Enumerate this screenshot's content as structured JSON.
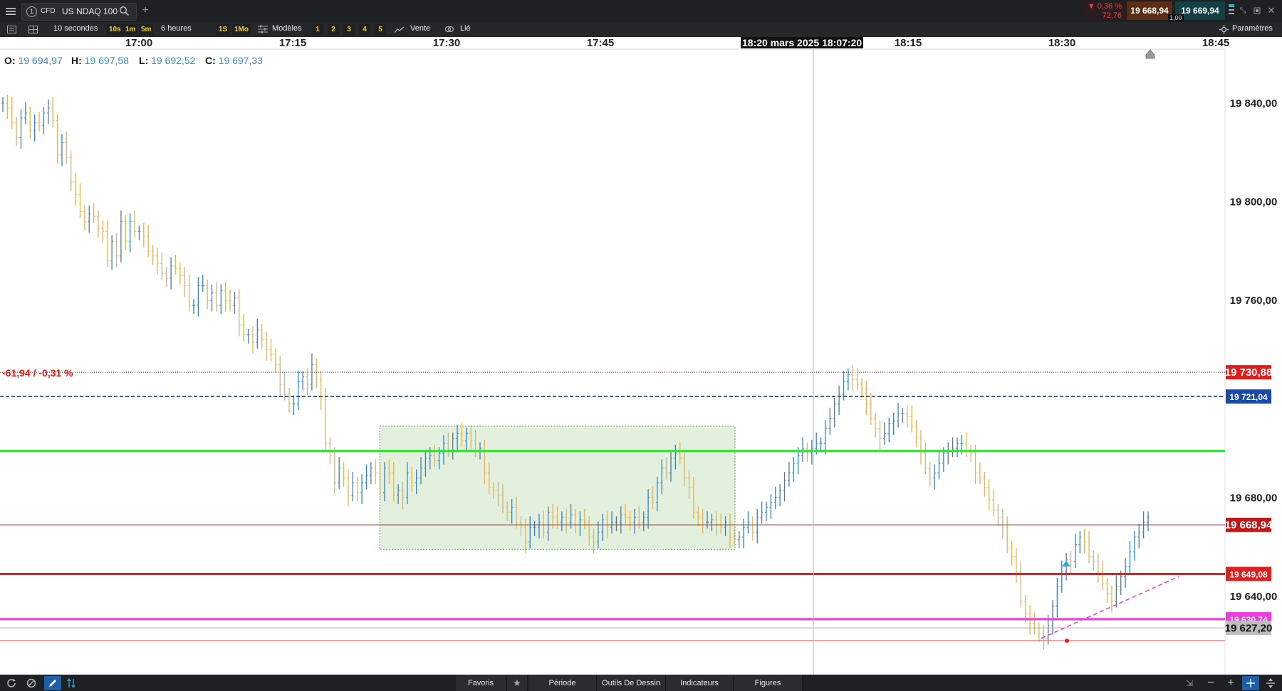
{
  "header": {
    "menu_icon": "hamburger-icon",
    "tab_number": "1",
    "instrument_type": "CFD",
    "instrument_name": "US NDAQ 100",
    "change_pct": "▼ 0,36 %",
    "change_abs": "72,76",
    "bid": "19 668,94",
    "ask": "19 669,94",
    "spread": "1,00"
  },
  "toolbar": {
    "interval": "10 secondes",
    "quick_intervals": [
      "10s",
      "1m",
      "5m"
    ],
    "range": "6 heures",
    "quick_ranges": [
      "1S",
      "1Mo"
    ],
    "templates_label": "Modèles",
    "template_slots": [
      "1",
      "2",
      "3",
      "4",
      "5"
    ],
    "sell_label": "Vente",
    "link_label": "Lié",
    "settings_label": "Paramètres"
  },
  "ohlc": {
    "o_label": "O:",
    "o_value": "19 694,97",
    "h_label": "H:",
    "h_value": "19 697,58",
    "l_label": "L:",
    "l_value": "19 692,52",
    "c_label": "C:",
    "c_value": "19 697,33"
  },
  "chart_data": {
    "type": "line",
    "style": "ohlc-bars",
    "x_ticks": [
      "17:00",
      "17:15",
      "17:30",
      "17:45",
      "18:15",
      "18:30",
      "18:45"
    ],
    "crosshair_time_label": "20 mars 2025 18:07:20",
    "crosshair_time_fragment": "18:",
    "y_ticks": [
      "19 840,00",
      "19 800,00",
      "19 760,00",
      "19 680,00",
      "19 640,00"
    ],
    "y_tick_values": [
      19840,
      19800,
      19760,
      19680,
      19640
    ],
    "ylim": [
      19616,
      19870
    ],
    "grid": false,
    "change_annotation": "-61,94 / -0,31 %",
    "levels": [
      {
        "label": "19 730,88",
        "value": 19730.88,
        "color": "#e21b1b",
        "style": "dotted"
      },
      {
        "label": "19 721,04",
        "value": 19721.04,
        "color": "#1a4aa8",
        "style": "dashed"
      },
      {
        "label": "19 668,94",
        "value": 19668.94,
        "color": "#c01818",
        "style": "solid-thin"
      },
      {
        "label": "19 649,08",
        "value": 19649.08,
        "color": "#e02020",
        "style": "solid-thick"
      },
      {
        "label": "19 630,74",
        "value": 19630.74,
        "color": "#ee3bdc",
        "style": "solid-thick"
      },
      {
        "label": "19 627,20",
        "value": 19627.2,
        "color": "#bdbdbd",
        "style": "cursor"
      }
    ],
    "green_level": {
      "value": 19699
    },
    "low_level": {
      "value": 19622
    },
    "zone": {
      "x_start": 0.31,
      "x_end": 0.6,
      "y_top": 19709,
      "y_bottom": 19659
    },
    "series": [
      {
        "values": [
          19840,
          19838,
          19832,
          19826,
          19834,
          19836,
          19829,
          19832,
          19831,
          19836,
          19838,
          19833,
          19819,
          19824,
          19818,
          19808,
          19803,
          19796,
          19792,
          19795,
          19794,
          19789,
          19788,
          19776,
          19784,
          19778,
          19792,
          19784,
          19792,
          19788,
          19788,
          19786,
          19780,
          19778,
          19775,
          19771,
          19769,
          19774,
          19773,
          19770,
          19766,
          19758,
          19758,
          19766,
          19766,
          19760,
          19763,
          19758,
          19764,
          19760,
          19758,
          19761,
          19750,
          19746,
          19746,
          19743,
          19748,
          19744,
          19740,
          19738,
          19734,
          19726,
          19722,
          19718,
          19718,
          19727,
          19729,
          19726,
          19734,
          19728,
          19720,
          19702,
          19697,
          19686,
          19692,
          19688,
          19681,
          19686,
          19682,
          19686,
          19689,
          19692,
          19690,
          19682,
          19692,
          19690,
          19681,
          19683,
          19680,
          19690,
          19686,
          19688,
          19692,
          19696,
          19697,
          19695,
          19698,
          19702,
          19699,
          19704,
          19706,
          19703,
          19706,
          19703,
          19699,
          19700,
          19690,
          19684,
          19683,
          19681,
          19676,
          19674,
          19676,
          19670,
          19668,
          19662,
          19668,
          19668,
          19670,
          19666,
          19674,
          19672,
          19670,
          19672,
          19670,
          19673,
          19669,
          19671,
          19670,
          19664,
          19662,
          19666,
          19671,
          19668,
          19670,
          19670,
          19673,
          19672,
          19670,
          19672,
          19670,
          19672,
          19680,
          19678,
          19686,
          19692,
          19690,
          19696,
          19698,
          19696,
          19688,
          19684,
          19674,
          19672,
          19670,
          19670,
          19671,
          19669,
          19668,
          19670,
          19664,
          19663,
          19664,
          19668,
          19670,
          19666,
          19672,
          19674,
          19676,
          19678,
          19680,
          19683,
          19687,
          19690,
          19694,
          19697,
          19700,
          19698,
          19700,
          19702,
          19702,
          19708,
          19712,
          19718,
          19722,
          19727,
          19730,
          19728,
          19726,
          19724,
          19718,
          19712,
          19708,
          19704,
          19706,
          19710,
          19711,
          19714,
          19714,
          19713,
          19709,
          19704,
          19698,
          19692,
          19688,
          19690,
          19694,
          19698,
          19699,
          19700,
          19702,
          19702,
          19699,
          19698,
          19690,
          19688,
          19684,
          19679,
          19675,
          19672,
          19668,
          19660,
          19656,
          19650,
          19638,
          19633,
          19629,
          19627,
          19625,
          19623,
          19628,
          19636,
          19644,
          19650,
          19655,
          19654,
          19661,
          19664,
          19662,
          19656,
          19654,
          19650,
          19645,
          19641,
          19638,
          19644,
          19648,
          19652,
          19658,
          19664,
          19666,
          19670,
          19672
        ]
      }
    ]
  },
  "bottom": {
    "favorites": "Favoris",
    "period": "Période",
    "drawing_tools": "Outils De Dessin",
    "indicators": "Indicateurs",
    "figures": "Figures"
  },
  "colors": {
    "bar_up": "#3a7fc0",
    "bar_down": "#e0b45a",
    "zone_fill": "#e3f0de",
    "zone_border": "#5aa55a",
    "green_line": "#33e033",
    "trend_line": "#ee3bdc"
  }
}
